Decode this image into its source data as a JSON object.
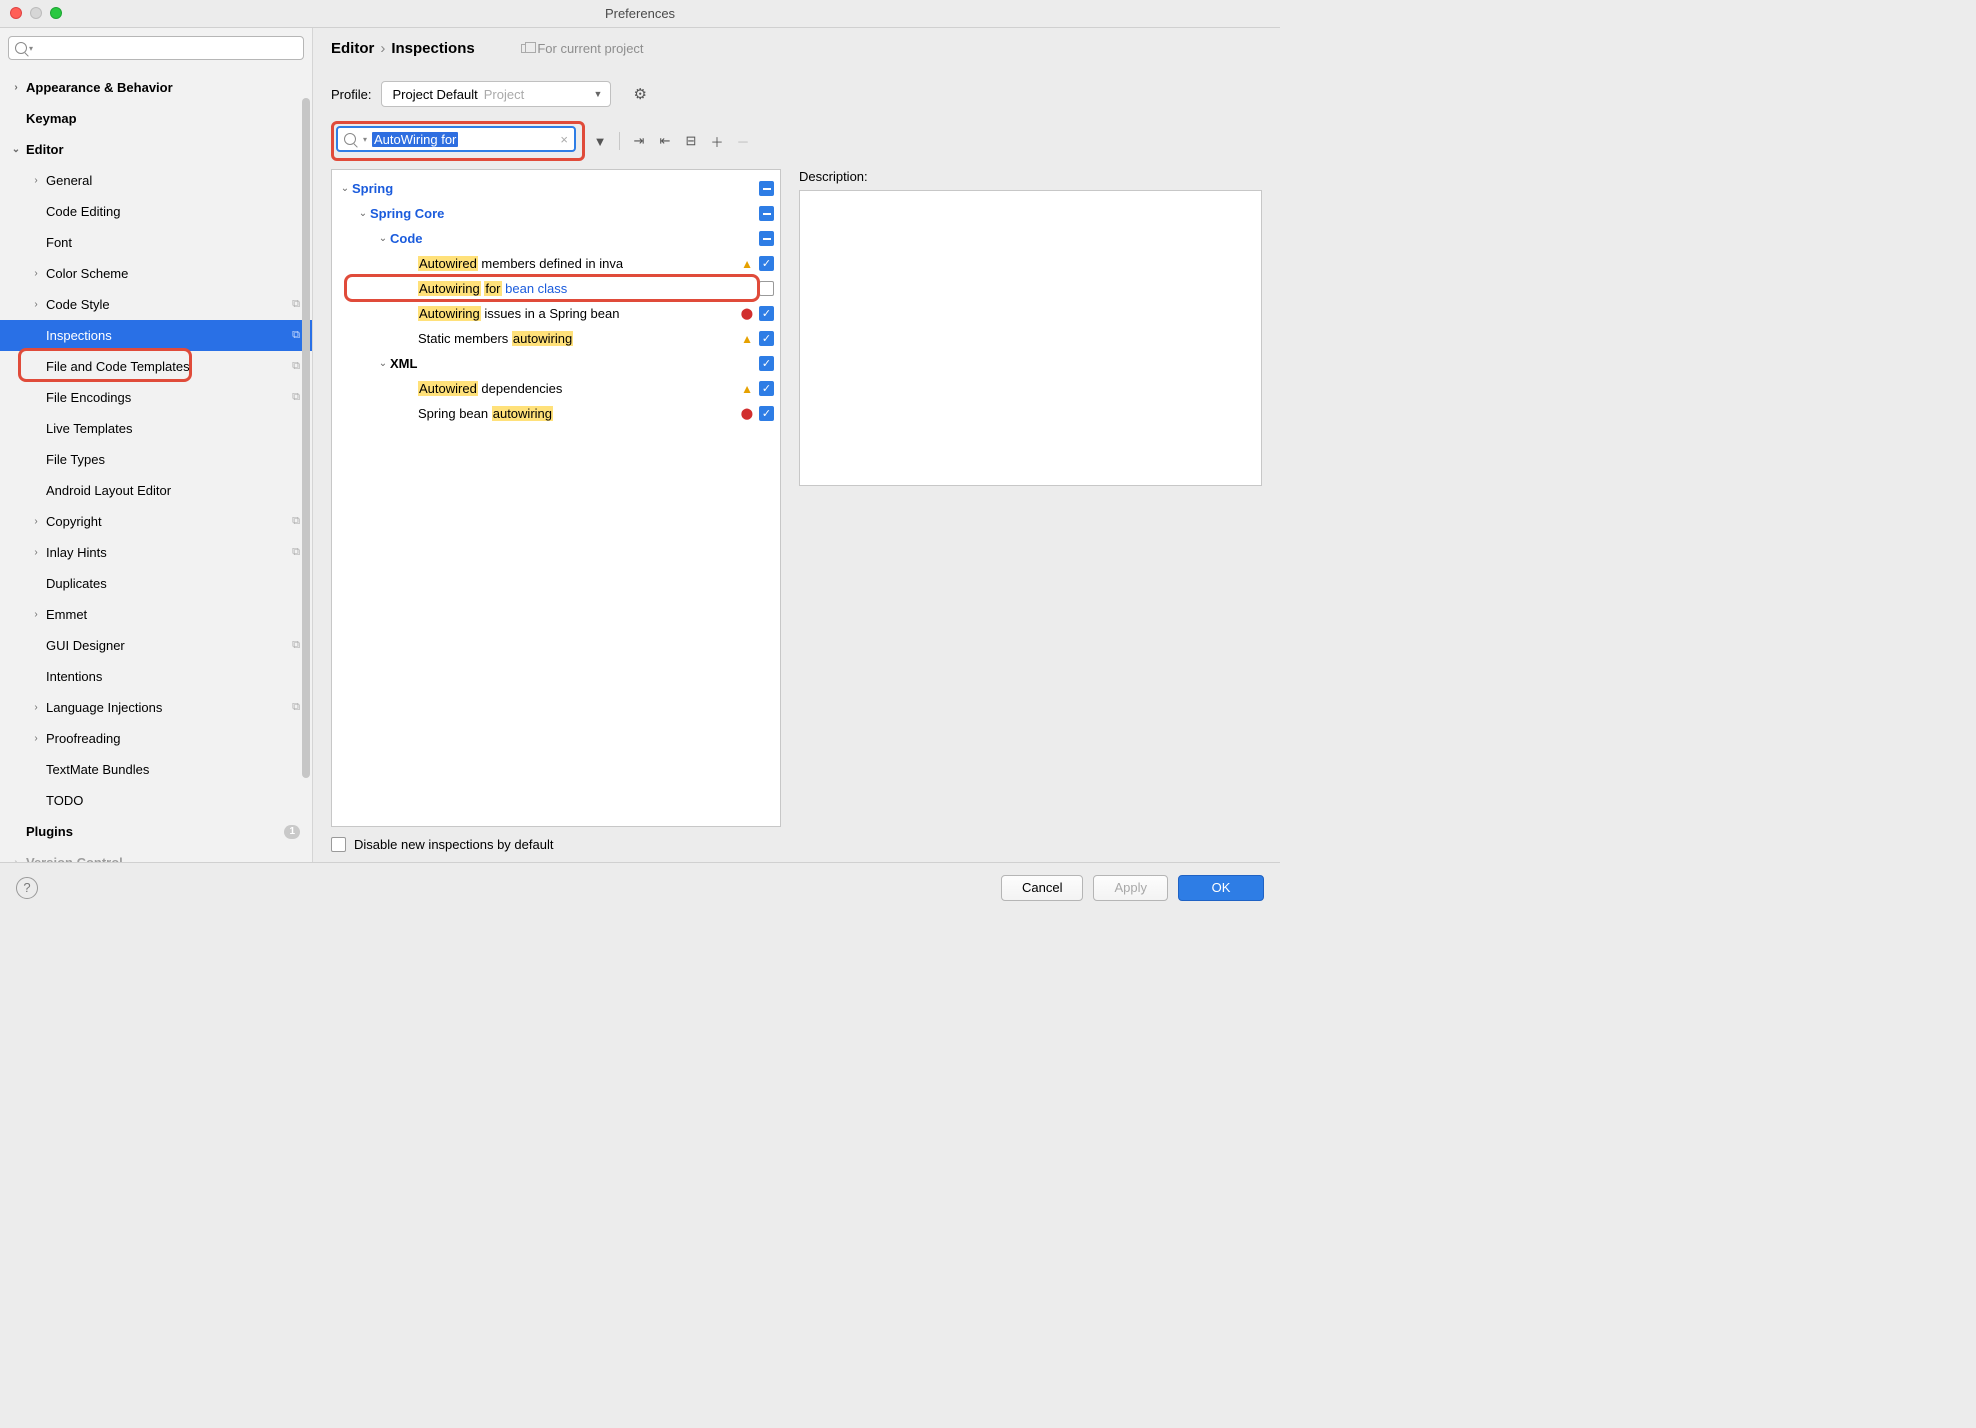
{
  "window": {
    "title": "Preferences"
  },
  "sidebar": {
    "search_placeholder": "",
    "items": [
      {
        "label": "Appearance & Behavior",
        "depth": 0,
        "chev": "right",
        "bold": true
      },
      {
        "label": "Keymap",
        "depth": 0,
        "chev": "none",
        "bold": true
      },
      {
        "label": "Editor",
        "depth": 0,
        "chev": "down",
        "bold": true
      },
      {
        "label": "General",
        "depth": 1,
        "chev": "right"
      },
      {
        "label": "Code Editing",
        "depth": 1,
        "chev": "none"
      },
      {
        "label": "Font",
        "depth": 1,
        "chev": "none"
      },
      {
        "label": "Color Scheme",
        "depth": 1,
        "chev": "right"
      },
      {
        "label": "Code Style",
        "depth": 1,
        "chev": "right",
        "copy": true
      },
      {
        "label": "Inspections",
        "depth": 1,
        "chev": "none",
        "copy": true,
        "selected": true
      },
      {
        "label": "File and Code Templates",
        "depth": 1,
        "chev": "none",
        "copy": true
      },
      {
        "label": "File Encodings",
        "depth": 1,
        "chev": "none",
        "copy": true
      },
      {
        "label": "Live Templates",
        "depth": 1,
        "chev": "none"
      },
      {
        "label": "File Types",
        "depth": 1,
        "chev": "none"
      },
      {
        "label": "Android Layout Editor",
        "depth": 1,
        "chev": "none"
      },
      {
        "label": "Copyright",
        "depth": 1,
        "chev": "right",
        "copy": true
      },
      {
        "label": "Inlay Hints",
        "depth": 1,
        "chev": "right",
        "copy": true
      },
      {
        "label": "Duplicates",
        "depth": 1,
        "chev": "none"
      },
      {
        "label": "Emmet",
        "depth": 1,
        "chev": "right"
      },
      {
        "label": "GUI Designer",
        "depth": 1,
        "chev": "none",
        "copy": true
      },
      {
        "label": "Intentions",
        "depth": 1,
        "chev": "none"
      },
      {
        "label": "Language Injections",
        "depth": 1,
        "chev": "right",
        "copy": true
      },
      {
        "label": "Proofreading",
        "depth": 1,
        "chev": "right"
      },
      {
        "label": "TextMate Bundles",
        "depth": 1,
        "chev": "none"
      },
      {
        "label": "TODO",
        "depth": 1,
        "chev": "none"
      },
      {
        "label": "Plugins",
        "depth": 0,
        "chev": "none",
        "bold": true,
        "badge": "1"
      },
      {
        "label": "Version Control",
        "depth": 0,
        "chev": "right",
        "bold": true,
        "cut": true
      }
    ]
  },
  "breadcrumb": {
    "a": "Editor",
    "b": "Inspections",
    "note": "For current project"
  },
  "profile": {
    "label": "Profile:",
    "value": "Project Default",
    "suffix": "Project"
  },
  "insp_search": {
    "value": "AutoWiring for"
  },
  "insp_tree": [
    {
      "d": 0,
      "chev": "down",
      "parts": [
        {
          "t": "Spring",
          "cls": "bluebold"
        }
      ],
      "cb": "mixed"
    },
    {
      "d": 1,
      "chev": "down",
      "parts": [
        {
          "t": "Spring Core",
          "cls": "bluebold"
        }
      ],
      "cb": "mixed"
    },
    {
      "d": 2,
      "chev": "down",
      "parts": [
        {
          "t": "Code",
          "cls": "bluebold"
        }
      ],
      "cb": "mixed"
    },
    {
      "d": 3,
      "parts": [
        {
          "t": "Autowired",
          "cls": "hl"
        },
        {
          "t": " members defined in inva"
        }
      ],
      "sev": "warn",
      "cb": "checked",
      "cut": true
    },
    {
      "d": 3,
      "parts": [
        {
          "t": "Autowiring",
          "cls": "hl"
        },
        {
          "t": " "
        },
        {
          "t": "for",
          "cls": "hl"
        },
        {
          "t": " "
        },
        {
          "t": "bean class",
          "cls": "bluetxt"
        }
      ],
      "cb": "unchecked",
      "annot": true
    },
    {
      "d": 3,
      "parts": [
        {
          "t": "Autowiring",
          "cls": "hl"
        },
        {
          "t": " issues in a Spring bean"
        }
      ],
      "sev": "err",
      "cb": "checked"
    },
    {
      "d": 3,
      "parts": [
        {
          "t": "Static members "
        },
        {
          "t": "autowiring",
          "cls": "hl"
        }
      ],
      "sev": "warn",
      "cb": "checked"
    },
    {
      "d": 2,
      "chev": "down",
      "parts": [
        {
          "t": "XML",
          "cls": "bold2"
        }
      ],
      "cb": "checked"
    },
    {
      "d": 3,
      "parts": [
        {
          "t": "Autowired",
          "cls": "hl"
        },
        {
          "t": " dependencies"
        }
      ],
      "sev": "warn",
      "cb": "checked"
    },
    {
      "d": 3,
      "parts": [
        {
          "t": "Spring bean "
        },
        {
          "t": "autowiring",
          "cls": "hl"
        }
      ],
      "sev": "err",
      "cb": "checked"
    }
  ],
  "desc_label": "Description:",
  "disable_new": "Disable new inspections by default",
  "footer": {
    "cancel": "Cancel",
    "apply": "Apply",
    "ok": "OK"
  }
}
